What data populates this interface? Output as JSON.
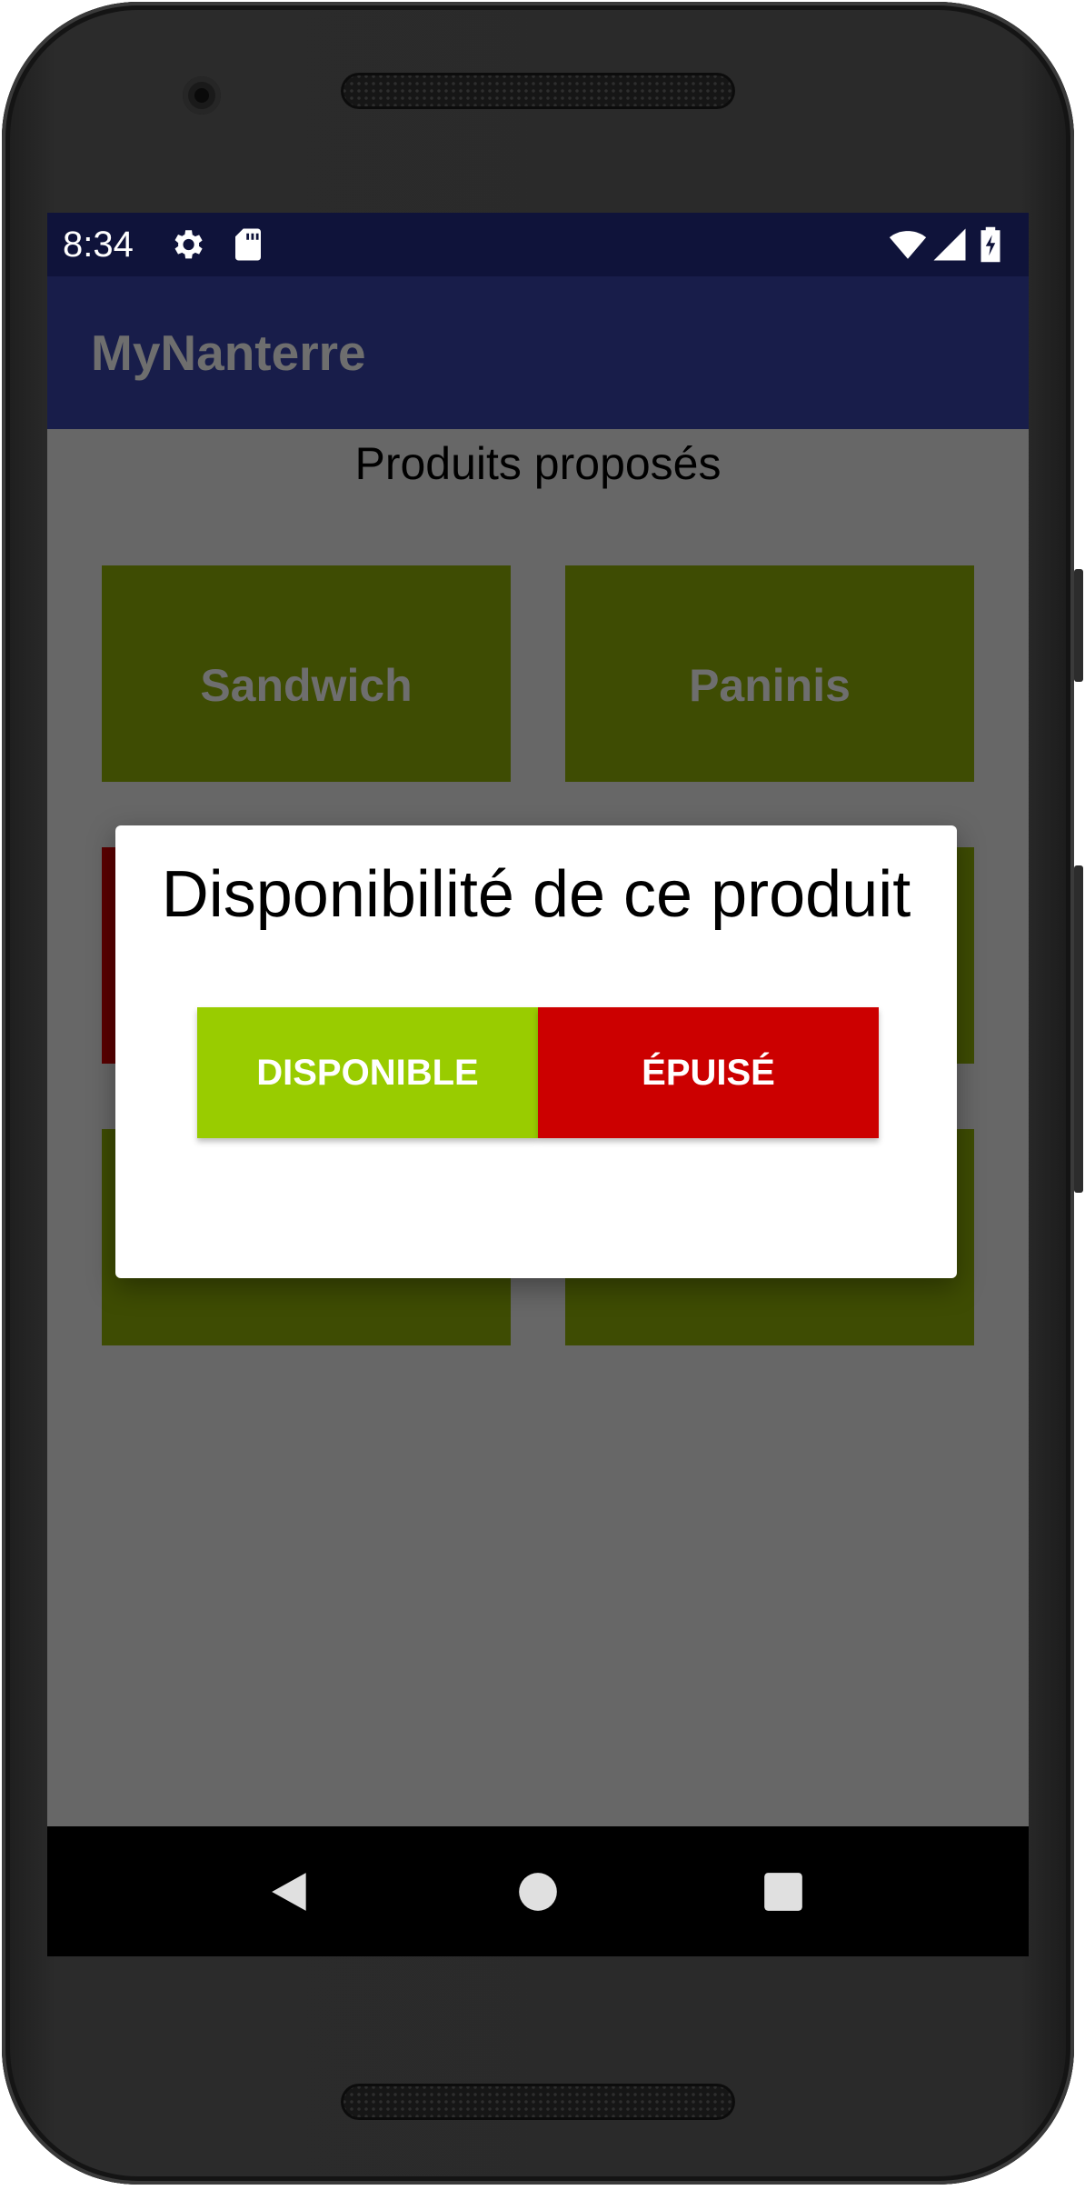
{
  "status_bar": {
    "time": "8:34",
    "icons": [
      "gear-icon",
      "sd-card-icon",
      "wifi-icon",
      "cell-signal-icon",
      "battery-charging-icon"
    ]
  },
  "app_bar": {
    "title": "MyNanterre"
  },
  "content": {
    "heading": "Produits proposés",
    "products": [
      {
        "label": "Sandwich"
      },
      {
        "label": "Paninis"
      },
      {
        "label": ""
      },
      {
        "label": ""
      },
      {
        "label": ""
      },
      {
        "label": ""
      }
    ]
  },
  "dialog": {
    "title": "Disponibilité de ce produit",
    "available_button": "DISPONIBLE",
    "sold_out_button": "ÉPUISÉ"
  },
  "colors": {
    "status_bar": "#0f133a",
    "app_bar": "#181d4a",
    "scrim_background": "#676767",
    "product_tile": "#3e4c03",
    "product_tile_unavailable": "#5a0000",
    "available_button": "#99cc00",
    "sold_out_button": "#cc0000"
  },
  "nav_bar": {
    "icons": [
      "back-icon",
      "home-icon",
      "recents-icon"
    ]
  }
}
